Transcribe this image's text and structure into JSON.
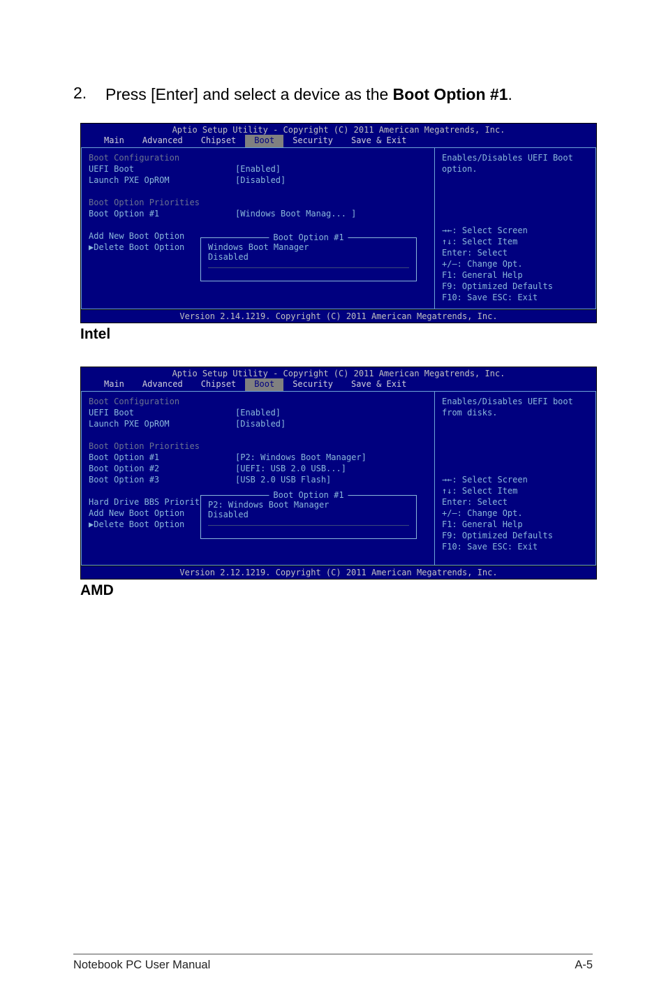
{
  "step": {
    "num": "2.",
    "text_pre": "Press [Enter] and select a device as the ",
    "text_bold": "Boot Option #1",
    "text_post": "."
  },
  "bios1": {
    "header": "Aptio Setup Utility - Copyright (C) 2011 American Megatrends, Inc.",
    "footer": "Version 2.14.1219. Copyright (C) 2011 American Megatrends, Inc.",
    "tabs": [
      "Main",
      "Advanced",
      "Chipset",
      "Boot",
      "Security",
      "Save & Exit"
    ],
    "active_tab": "Boot",
    "left": {
      "l0": "Boot Configuration",
      "l1_lab": "UEFI Boot",
      "l1_val": "[Enabled]",
      "l2_lab": "Launch PXE OpROM",
      "l2_val": "[Disabled]",
      "l3": "Boot Option Priorities",
      "l4_lab": "Boot Option #1",
      "l4_val": "[Windows Boot Manag... ]",
      "l5": "Add New Boot Option",
      "l6": "Delete Boot Option"
    },
    "popup": {
      "title": "Boot Option #1",
      "o1": "Windows Boot Manager",
      "o2": "Disabled"
    },
    "right": {
      "help": "Enables/Disables UEFI Boot option.",
      "k1": "→←:  Select Screen",
      "k2": "↑↓:   Select Item",
      "k3": "Enter: Select",
      "k4": "+/—:  Change Opt.",
      "k5": "F1:   General Help",
      "k6": "F9:   Optimized Defaults",
      "k7": "F10:  Save   ESC: Exit"
    }
  },
  "caption1": "Intel",
  "bios2": {
    "header": "Aptio Setup Utility - Copyright (C) 2011 American Megatrends, Inc.",
    "footer": "Version 2.12.1219. Copyright (C) 2011 American Megatrends, Inc.",
    "tabs": [
      "Main",
      "Advanced",
      "Chipset",
      "Boot",
      "Security",
      "Save & Exit"
    ],
    "active_tab": "Boot",
    "left": {
      "l0": "Boot Configuration",
      "l1_lab": "UEFI Boot",
      "l1_val": "[Enabled]",
      "l2_lab": "Launch PXE OpROM",
      "l2_val": "[Disabled]",
      "l3": "Boot Option Priorities",
      "l4_lab": "Boot Option #1",
      "l4_val": "[P2:  Windows Boot Manager]",
      "l5_lab": "Boot Option #2",
      "l5_val": "[UEFI: USB 2.0 USB...]",
      "l6_lab": "Boot Option #3",
      "l6_val": "[USB 2.0 USB Flash]",
      "l7": "Hard Drive BBS Priorities",
      "l8": "Add New Boot Option",
      "l9": "Delete Boot Option"
    },
    "popup": {
      "title": "Boot Option #1",
      "o1": "P2:  Windows Boot Manager",
      "o2": "Disabled"
    },
    "right": {
      "help": "Enables/Disables UEFI boot from disks.",
      "k1": "→←:  Select Screen",
      "k2": "↑↓:   Select Item",
      "k3": "Enter: Select",
      "k4": "+/—:  Change Opt.",
      "k5": "F1:   General Help",
      "k6": "F9:   Optimized Defaults",
      "k7": "F10:  Save   ESC: Exit"
    }
  },
  "caption2": "AMD",
  "footer": {
    "left": "Notebook PC User Manual",
    "right": "A-5"
  }
}
